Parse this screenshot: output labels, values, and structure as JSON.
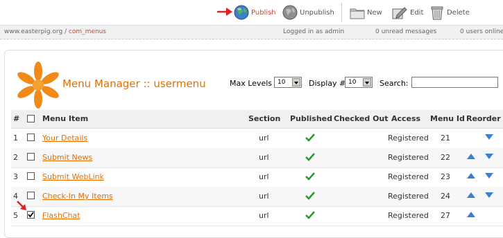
{
  "toolbar": {
    "publish": "Publish",
    "unpublish": "Unpublish",
    "new": "New",
    "edit": "Edit",
    "delete": "Delete"
  },
  "status": {
    "site": "www.easterpig.org",
    "sep": " / ",
    "component": "com_menus",
    "login": "Logged in as admin",
    "unread": "0 unread messages",
    "users": "0 users online"
  },
  "header": {
    "title": "Menu Manager :: usermenu",
    "max_levels_label": "Max Levels",
    "max_levels_value": "10",
    "display_label": "Display #",
    "display_value": "10",
    "search_label": "Search:",
    "search_value": ""
  },
  "table": {
    "columns": {
      "num": "#",
      "item": "Menu Item",
      "section": "Section",
      "published": "Published",
      "checked_out": "Checked Out",
      "access": "Access",
      "menu_id": "Menu Id",
      "reorder": "Reorder"
    },
    "rows": [
      {
        "num": "1",
        "item": "Your Details",
        "section": "url",
        "access": "Registered",
        "menu_id": "21",
        "checked": false,
        "up": false,
        "down": true
      },
      {
        "num": "2",
        "item": "Submit News",
        "section": "url",
        "access": "Registered",
        "menu_id": "22",
        "checked": false,
        "up": true,
        "down": true
      },
      {
        "num": "3",
        "item": "Submit WebLink",
        "section": "url",
        "access": "Registered",
        "menu_id": "23",
        "checked": false,
        "up": true,
        "down": true
      },
      {
        "num": "4",
        "item": "Check-In My Items",
        "section": "url",
        "access": "Registered",
        "menu_id": "24",
        "checked": false,
        "up": true,
        "down": true
      },
      {
        "num": "5",
        "item": "FlashChat",
        "section": "url",
        "access": "Registered",
        "menu_id": "27",
        "checked": true,
        "up": true,
        "down": false
      }
    ]
  },
  "colors": {
    "accent": "#e66e00",
    "link": "#e66e00",
    "annotation_arrow": "#e02020",
    "published_tick": "#2a9a2a",
    "reorder_arrow": "#3a7fd0"
  }
}
